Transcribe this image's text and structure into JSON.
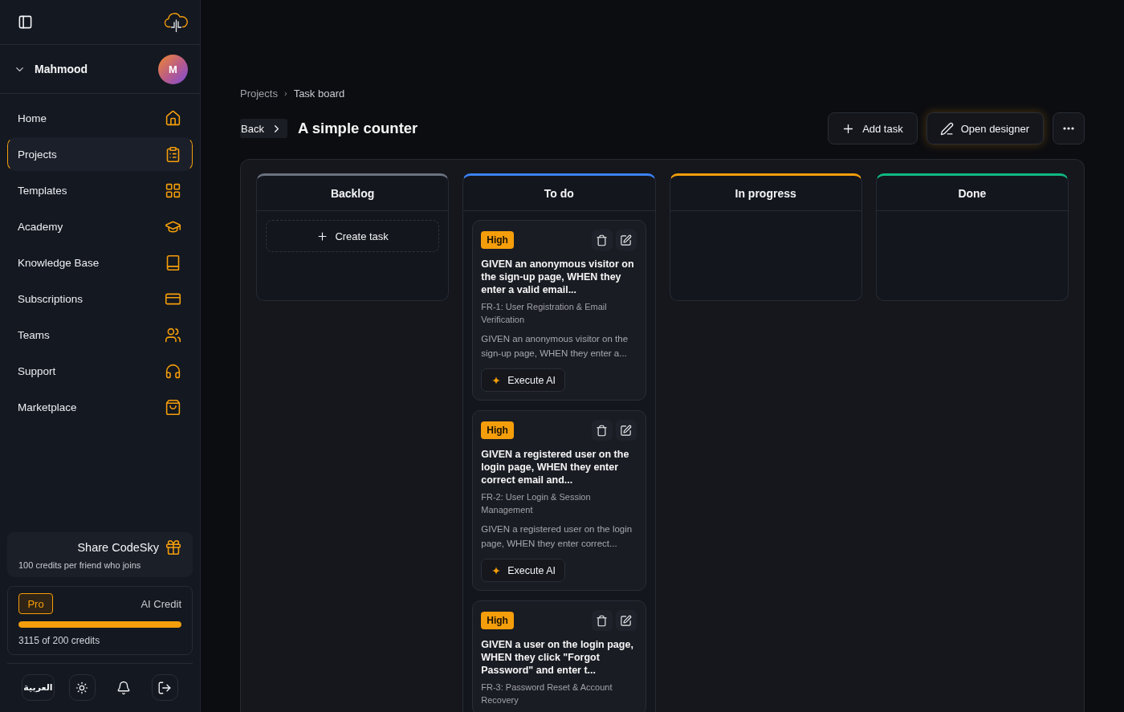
{
  "sidebar": {
    "user": {
      "name": "Mahmood",
      "initial": "M"
    },
    "nav_items": [
      {
        "label": "Home",
        "selected": false
      },
      {
        "label": "Projects",
        "selected": true
      },
      {
        "label": "Templates",
        "selected": false
      },
      {
        "label": "Academy",
        "selected": false
      },
      {
        "label": "Knowledge Base",
        "selected": false
      },
      {
        "label": "Subscriptions",
        "selected": false
      },
      {
        "label": "Teams",
        "selected": false
      },
      {
        "label": "Support",
        "selected": false
      },
      {
        "label": "Marketplace",
        "selected": false
      }
    ],
    "share": {
      "title": "Share CodeSky",
      "subtitle": "100 credits per friend who joins"
    },
    "credits": {
      "plan": "Pro",
      "label": "AI Credit",
      "level": 1,
      "usage": "3115 of 200 credits"
    },
    "language": "العربية"
  },
  "breadcrumb": {
    "items": [
      "Projects",
      "Task board"
    ],
    "separator": "›"
  },
  "header": {
    "back": "Back",
    "title": "A simple counter",
    "actions": [
      {
        "kind": "add",
        "label": "Add task"
      },
      {
        "kind": "designer",
        "label": "Open designer"
      },
      {
        "kind": "more"
      }
    ]
  },
  "board": {
    "columns": [
      {
        "title": "Backlog",
        "color": "#6b7280",
        "create_label": "Create task"
      },
      {
        "title": "To do",
        "color": "#3b82f6",
        "tasks": [
          {
            "priority": "High",
            "title": "GIVEN an anonymous visitor on the sign-up page, WHEN they enter a valid email...",
            "requirement": "FR-1: User Registration & Email Verification",
            "description": "GIVEN an anonymous visitor on the sign-up page, WHEN they enter a...",
            "action": "Execute AI"
          },
          {
            "priority": "High",
            "title": "GIVEN a registered user on the login page, WHEN they enter correct email and...",
            "requirement": "FR-2: User Login & Session Management",
            "description": "GIVEN a registered user on the login page, WHEN they enter correct...",
            "action": "Execute AI"
          },
          {
            "priority": "High",
            "title": "GIVEN a user on the login page, WHEN they click \"Forgot Password\" and enter t...",
            "requirement": "FR-3: Password Reset & Account Recovery"
          }
        ]
      },
      {
        "title": "In progress",
        "color": "#f59e0b"
      },
      {
        "title": "Done",
        "color": "#10b981"
      }
    ]
  }
}
